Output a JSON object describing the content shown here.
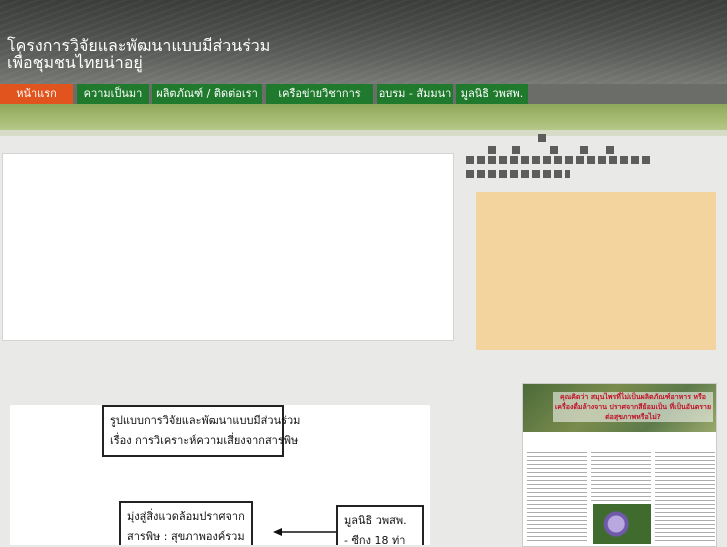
{
  "site": {
    "title_line1": "โครงการวิจัยและพัฒนาแบบมีส่วนร่วม",
    "title_line2": "เพื่อชุมชนไทยน่าอยู่"
  },
  "nav": {
    "items": [
      {
        "label": "หน้าแรก",
        "active": true
      },
      {
        "label": "ความเป็นมา"
      },
      {
        "label": "ผลิตภัณฑ์ / ติดต่อเรา"
      },
      {
        "label": "เครือข่ายวิชาการ"
      },
      {
        "label": "อบรม - สัมมนา"
      },
      {
        "label": "มูลนิธิ วพสพ."
      }
    ]
  },
  "diagram": {
    "box1_line1": "รูปแบบการวิจัยและพัฒนาแบบมีส่วนร่วม",
    "box1_line2": "เรื่อง การวิเคราะห์ความเสี่ยงจากสารพิษ",
    "box2_line1": "มุ่งสู่สิ่งแวดล้อมปราศจาก",
    "box2_line2": "สารพิษ : สุขภาพองค์รวม",
    "box3_line1": "มูลนิธิ วพสพ.",
    "box3_line2": "- ซีกง 18 ท่า"
  },
  "poster": {
    "headline": "คุณคิดว่า สมุนไพรที่ไม่เป็นผลิตภัณฑ์อาหาร หรือ เครื่องดื่มล้างจาน ปราศจากสีย้อมเป็น ที่เป็นอันตรายต่อสุขภาพหรือไม่?"
  },
  "colors": {
    "header_dark": "#3b3d3a",
    "nav_home": "#e2541d",
    "nav_green": "#1f7a2d",
    "band_green": "#a6bb73",
    "side_panel": "#f3d49e"
  }
}
